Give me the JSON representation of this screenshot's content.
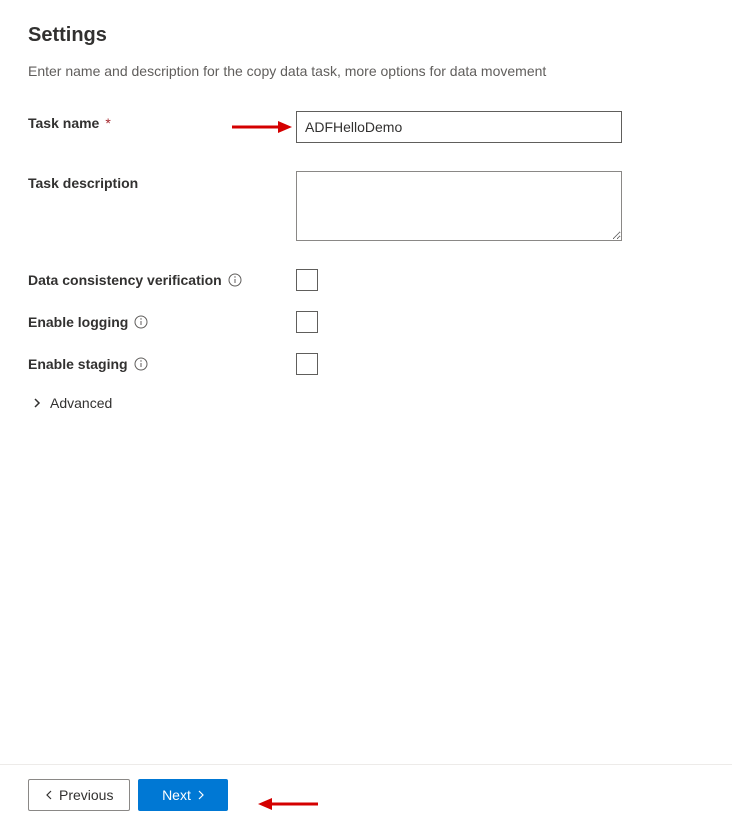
{
  "page": {
    "title": "Settings",
    "subtitle": "Enter name and description for the copy data task, more options for data movement"
  },
  "form": {
    "task_name": {
      "label": "Task name",
      "required_marker": "*",
      "value": "ADFHelloDemo"
    },
    "task_description": {
      "label": "Task description",
      "value": ""
    },
    "data_consistency": {
      "label": "Data consistency verification",
      "checked": false
    },
    "enable_logging": {
      "label": "Enable logging",
      "checked": false
    },
    "enable_staging": {
      "label": "Enable staging",
      "checked": false
    },
    "advanced": {
      "label": "Advanced"
    }
  },
  "footer": {
    "previous_label": "Previous",
    "next_label": "Next"
  },
  "colors": {
    "primary": "#0078d4",
    "text": "#323130",
    "subtext": "#605e5c",
    "border": "#8a8886",
    "required": "#a4262c",
    "annotation": "#d40000"
  }
}
